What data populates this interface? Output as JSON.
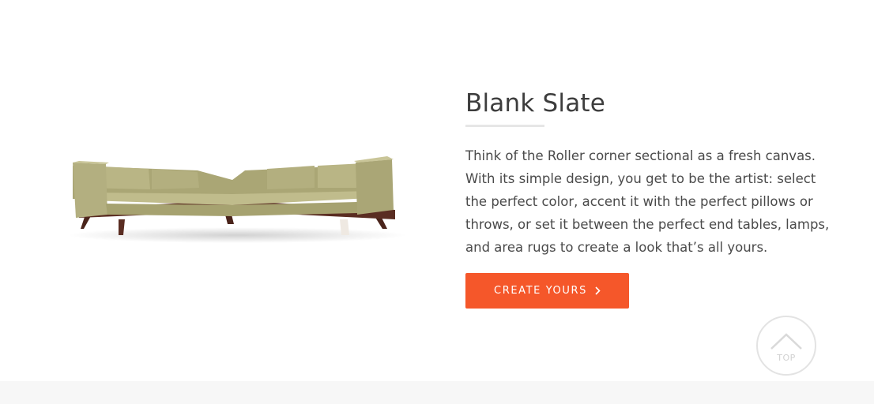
{
  "section": {
    "title": "Blank Slate",
    "description": "Think of the Roller corner sectional as a fresh canvas. With its simple design, you get to be the artist: select the perfect color, accent it with the perfect pillows or throws, or set it between the perfect end tables, lamps, and area rugs to create a look that’s all yours.",
    "cta_label": "CREATE YOURS"
  },
  "top_button": {
    "label": "TOP"
  },
  "icons": {
    "cta": "chevron-right-icon",
    "top": "chevron-up-icon"
  },
  "colors": {
    "accent": "#f5572a",
    "sofa": "#b7b383",
    "legs": "#5a2d22"
  }
}
